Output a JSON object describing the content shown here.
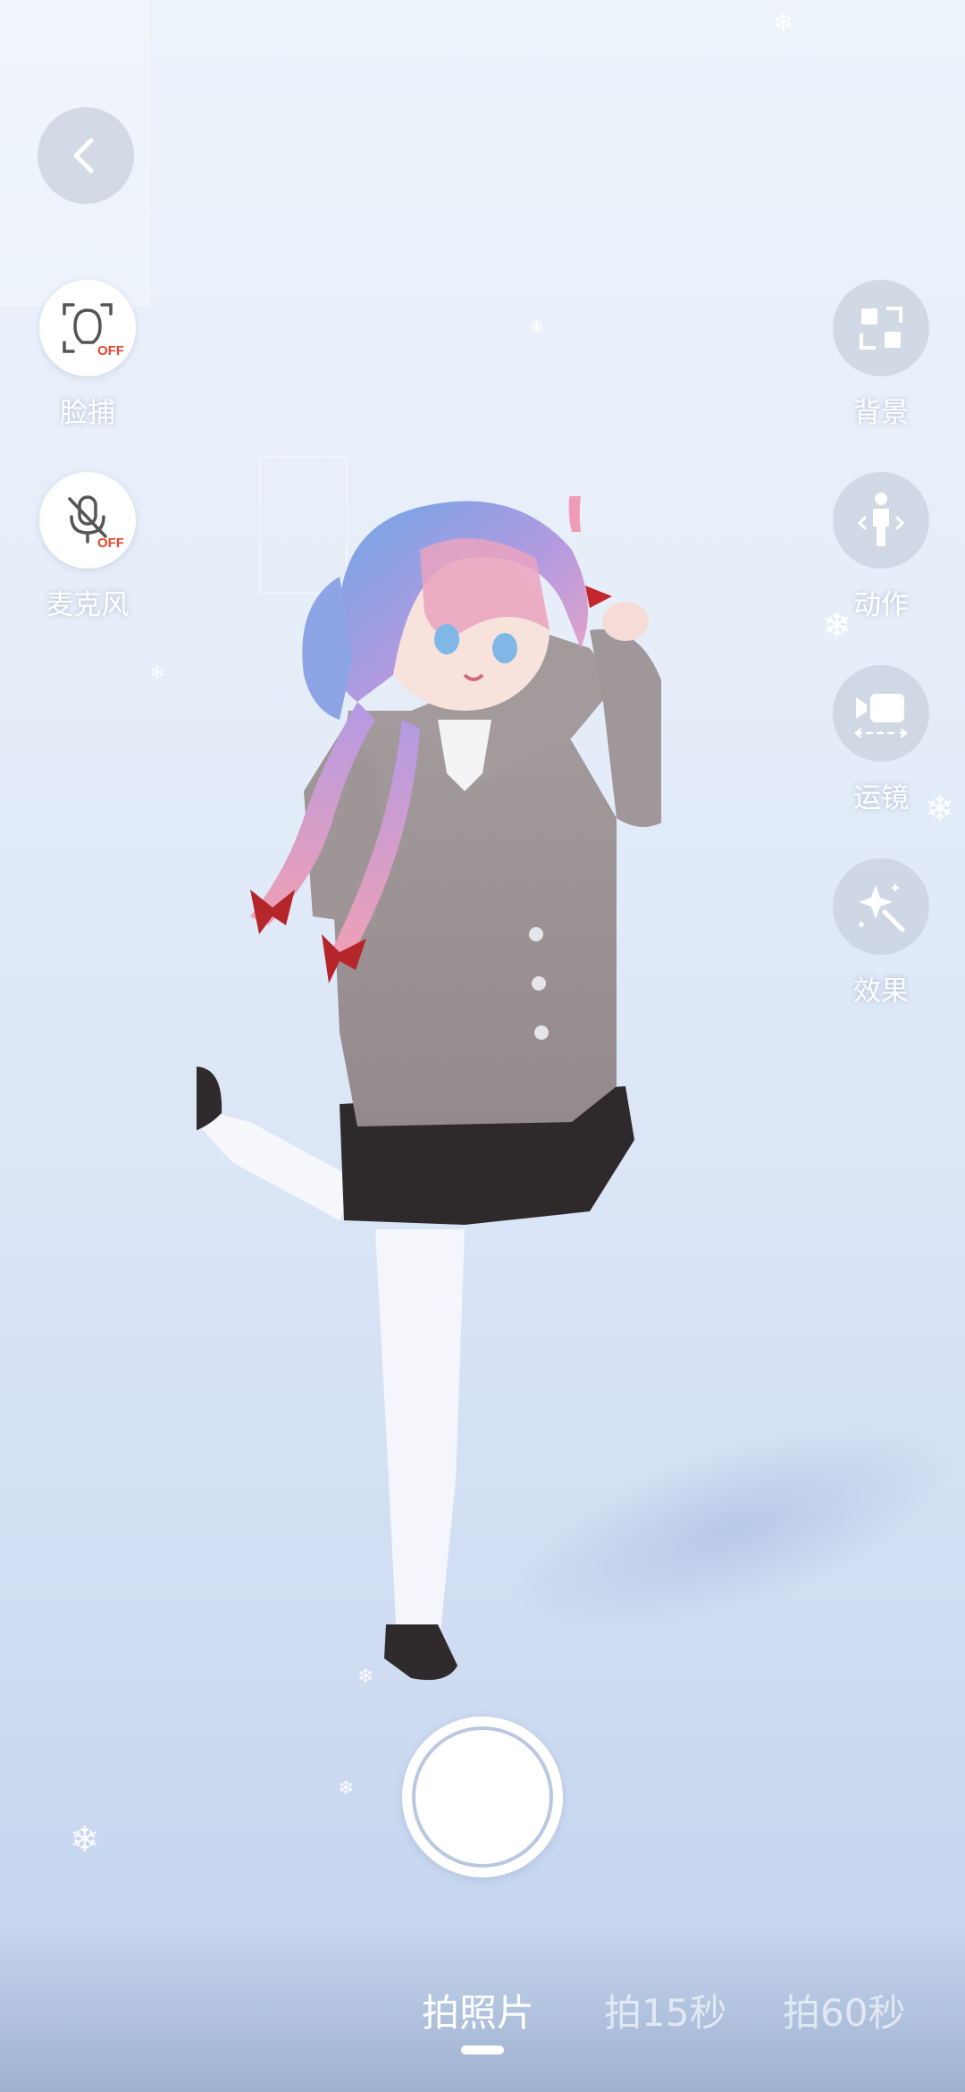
{
  "top_bar": {
    "back_icon": "chevron-left-icon"
  },
  "left_tools": [
    {
      "label": "脸捕",
      "icon": "face-capture-icon",
      "state": "OFF"
    },
    {
      "label": "麦克风",
      "icon": "mic-off-icon",
      "state": "OFF"
    }
  ],
  "right_tools": [
    {
      "label": "背景",
      "icon": "background-grid-icon"
    },
    {
      "label": "动作",
      "icon": "person-pose-icon"
    },
    {
      "label": "运镜",
      "icon": "camera-move-icon"
    },
    {
      "label": "效果",
      "icon": "sparkle-effect-icon"
    }
  ],
  "shutter": {
    "icon": "shutter-icon"
  },
  "mode_tabs": [
    {
      "label": "拍照片",
      "active": true
    },
    {
      "label": "拍15秒",
      "active": false
    },
    {
      "label": "拍60秒",
      "active": false
    }
  ],
  "colors": {
    "off_badge": "#e8442b",
    "icon_dark": "#555555",
    "label_white": "#ffffff"
  }
}
